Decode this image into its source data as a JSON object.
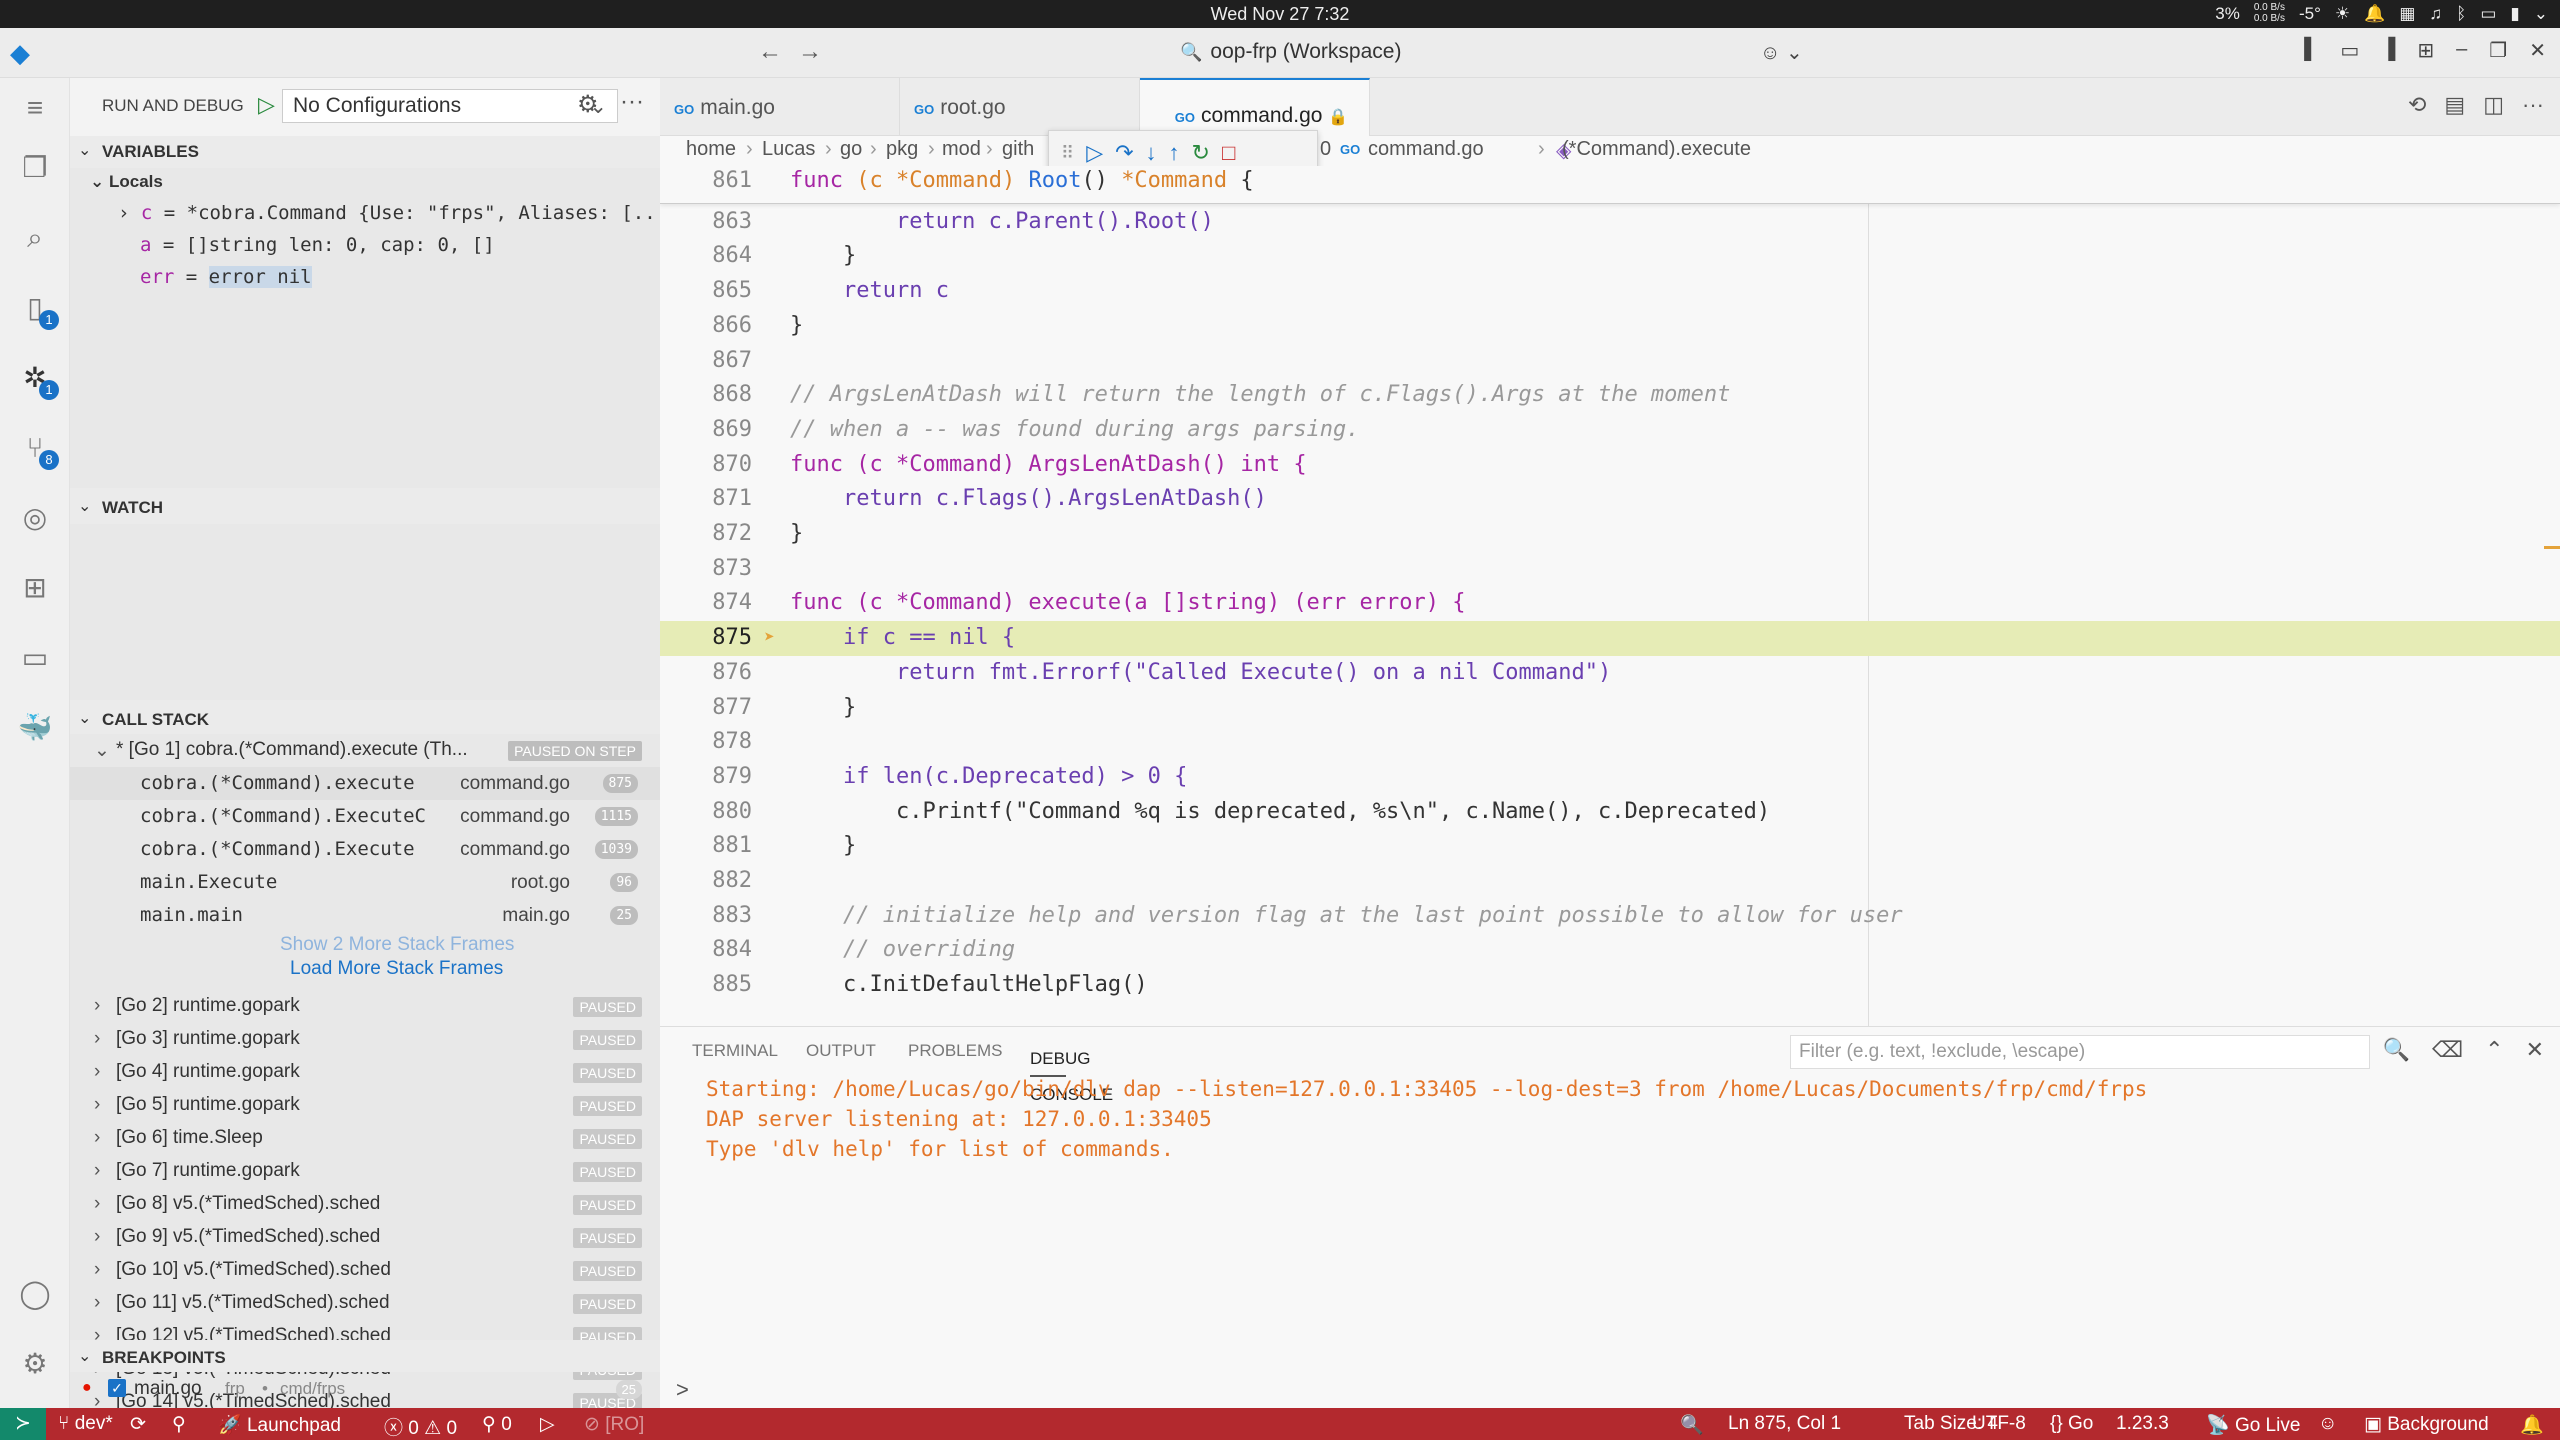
{
  "os": {
    "clock": "Wed Nov 27 7:32",
    "cpu": "3%",
    "net_up": "0.0 B/s",
    "net_down": "0.0 B/s",
    "temp": "-5°"
  },
  "titlebar": {
    "command_center": "oop-frp (Workspace)"
  },
  "activity": {
    "explorer_badge": "",
    "source_badge": "1",
    "debug_badge": "1",
    "scm_badge": "8"
  },
  "sidebar": {
    "title": "RUN AND DEBUG",
    "config": "No Configurations",
    "variables_title": "VARIABLES",
    "locals_label": "Locals",
    "vars": [
      {
        "name": "c",
        "value": "*cobra.Command {Use: \"frps\", Aliases: [..."
      },
      {
        "name": "a",
        "value": "[]string len: 0, cap: 0, []"
      },
      {
        "name": "err",
        "value": "error nil"
      }
    ],
    "watch_title": "WATCH",
    "callstack_title": "CALL STACK",
    "thread_main": "* [Go 1] cobra.(*Command).execute (Th...",
    "thread_main_state": "PAUSED ON STEP",
    "frames": [
      {
        "name": "cobra.(*Command).execute",
        "file": "command.go",
        "line": "875"
      },
      {
        "name": "cobra.(*Command).ExecuteC",
        "file": "command.go",
        "line": "1115"
      },
      {
        "name": "cobra.(*Command).Execute",
        "file": "command.go",
        "line": "1039"
      },
      {
        "name": "main.Execute",
        "file": "root.go",
        "line": "96"
      },
      {
        "name": "main.main",
        "file": "main.go",
        "line": "25"
      }
    ],
    "show_more": "Show 2 More Stack Frames",
    "load_more": "Load More Stack Frames",
    "threads": [
      {
        "name": "[Go 2] runtime.gopark",
        "state": "PAUSED"
      },
      {
        "name": "[Go 3] runtime.gopark",
        "state": "PAUSED"
      },
      {
        "name": "[Go 4] runtime.gopark",
        "state": "PAUSED"
      },
      {
        "name": "[Go 5] runtime.gopark",
        "state": "PAUSED"
      },
      {
        "name": "[Go 6] time.Sleep",
        "state": "PAUSED"
      },
      {
        "name": "[Go 7] runtime.gopark",
        "state": "PAUSED"
      },
      {
        "name": "[Go 8] v5.(*TimedSched).sched",
        "state": "PAUSED"
      },
      {
        "name": "[Go 9] v5.(*TimedSched).sched",
        "state": "PAUSED"
      },
      {
        "name": "[Go 10] v5.(*TimedSched).sched",
        "state": "PAUSED"
      },
      {
        "name": "[Go 11] v5.(*TimedSched).sched",
        "state": "PAUSED"
      },
      {
        "name": "[Go 12] v5.(*TimedSched).sched",
        "state": "PAUSED"
      },
      {
        "name": "[Go 13] v5.(*TimedSched).sched",
        "state": "PAUSED"
      },
      {
        "name": "[Go 14] v5.(*TimedSched).sched",
        "state": "PAUSED"
      }
    ],
    "breakpoints_title": "BREAKPOINTS",
    "breakpoint": {
      "file": "main.go",
      "project": "frp",
      "path": "cmd/frps",
      "line": "25"
    }
  },
  "tabs": [
    {
      "label": "main.go"
    },
    {
      "label": "root.go"
    },
    {
      "label": "command.go"
    }
  ],
  "breadcrumbs": [
    "home",
    "Lucas",
    "go",
    "pkg",
    "mod",
    "gith",
    "0",
    "command.go",
    "(*Command).execute"
  ],
  "editor": {
    "sticky_num": "861",
    "current_line": "875",
    "lines": [
      {
        "num": "863",
        "code": "        return c.Parent().Root()"
      },
      {
        "num": "864",
        "code": "    }"
      },
      {
        "num": "865",
        "code": "    return c"
      },
      {
        "num": "866",
        "code": "}"
      },
      {
        "num": "867",
        "code": ""
      },
      {
        "num": "868",
        "code": "// ArgsLenAtDash will return the length of c.Flags().Args at the moment"
      },
      {
        "num": "869",
        "code": "// when a -- was found during args parsing."
      },
      {
        "num": "870",
        "code": "func (c *Command) ArgsLenAtDash() int {"
      },
      {
        "num": "871",
        "code": "    return c.Flags().ArgsLenAtDash()"
      },
      {
        "num": "872",
        "code": "}"
      },
      {
        "num": "873",
        "code": ""
      },
      {
        "num": "874",
        "code": "func (c *Command) execute(a []string) (err error) {"
      },
      {
        "num": "875",
        "code": "    if c == nil {"
      },
      {
        "num": "876",
        "code": "        return fmt.Errorf(\"Called Execute() on a nil Command\")"
      },
      {
        "num": "877",
        "code": "    }"
      },
      {
        "num": "878",
        "code": ""
      },
      {
        "num": "879",
        "code": "    if len(c.Deprecated) > 0 {"
      },
      {
        "num": "880",
        "code": "        c.Printf(\"Command %q is deprecated, %s\\n\", c.Name(), c.Deprecated)"
      },
      {
        "num": "881",
        "code": "    }"
      },
      {
        "num": "882",
        "code": ""
      },
      {
        "num": "883",
        "code": "    // initialize help and version flag at the last point possible to allow for user"
      },
      {
        "num": "884",
        "code": "    // overriding"
      },
      {
        "num": "885",
        "code": "    c.InitDefaultHelpFlag()"
      }
    ]
  },
  "panel": {
    "tabs": [
      "TERMINAL",
      "OUTPUT",
      "PROBLEMS",
      "DEBUG CONSOLE"
    ],
    "filter_placeholder": "Filter (e.g. text, !exclude, \\escape)",
    "output": [
      "Starting: /home/Lucas/go/bin/dlv dap --listen=127.0.0.1:33405 --log-dest=3 from /home/Lucas/Documents/frp/cmd/frps",
      "DAP server listening at: 127.0.0.1:33405",
      "Type 'dlv help' for list of commands."
    ],
    "prompt": ">"
  },
  "status": {
    "branch": "dev*",
    "launchpad": "Launchpad",
    "errors": "0",
    "warnings": "0",
    "ports": "0",
    "readonly": "[RO]",
    "position": "Ln 875, Col 1",
    "tab_size": "Tab Size: 4",
    "encoding": "UTF-8",
    "language": "Go",
    "go_version": "1.23.3",
    "go_live": "Go Live",
    "background": "Background"
  }
}
